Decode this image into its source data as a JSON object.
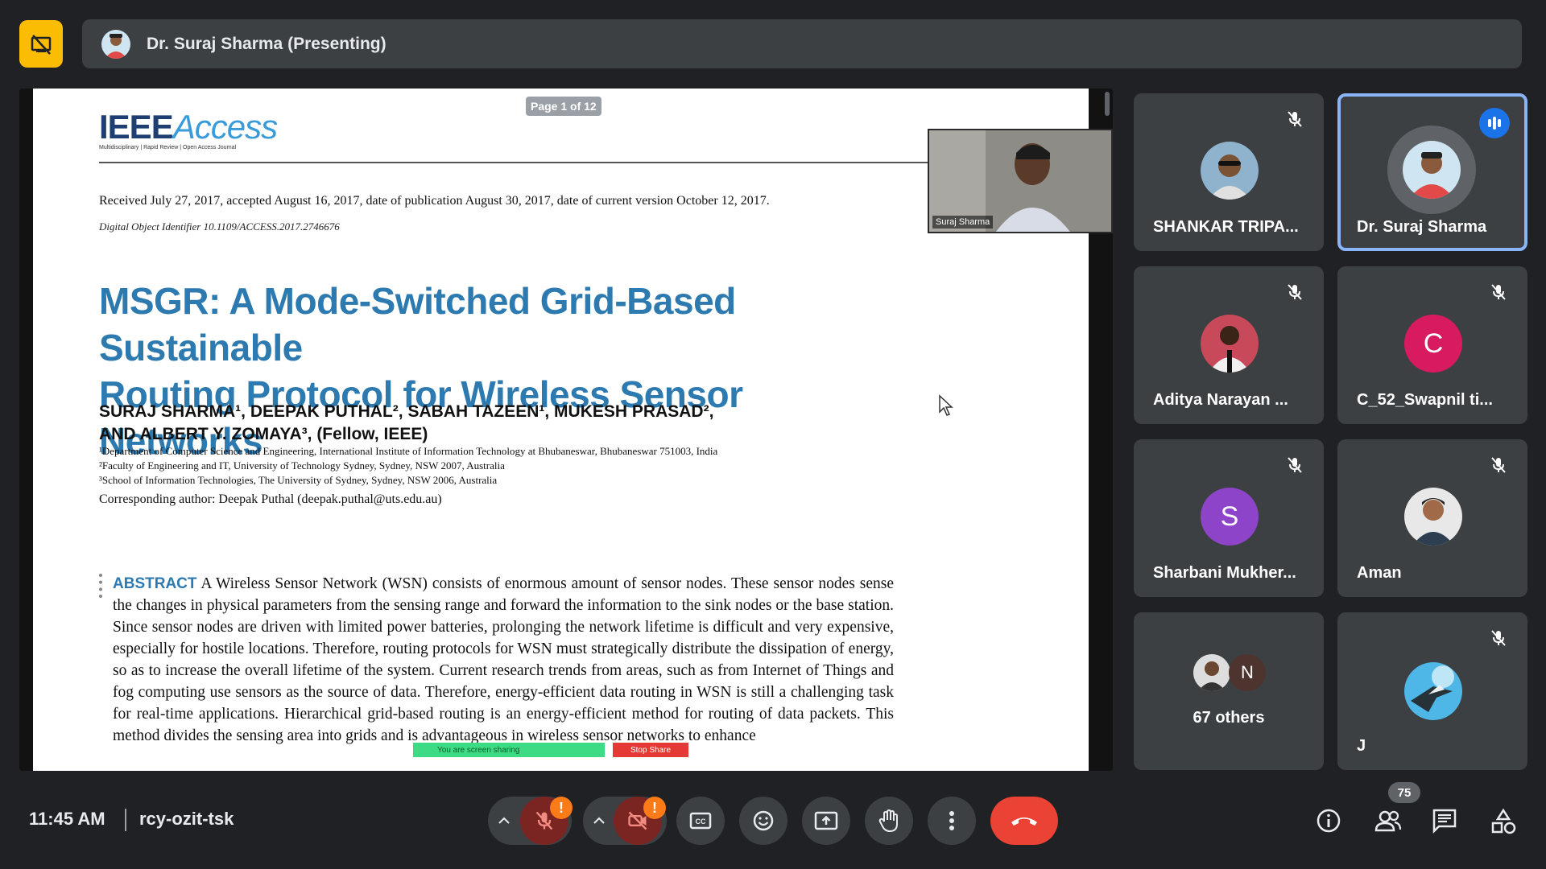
{
  "presenter_bar": {
    "label": "Dr. Suraj Sharma (Presenting)"
  },
  "document": {
    "page_indicator": "Page 1 of 12",
    "journal_logo_main": "IEEE",
    "journal_logo_accent": "Access",
    "journal_logo_sub": "Multidisciplinary | Rapid Review | Open Access Journal",
    "received_line": "Received July 27, 2017, accepted August 16, 2017, date of publication August 30, 2017, date of current version October 12, 2017.",
    "doi_line": "Digital Object Identifier 10.1109/ACCESS.2017.2746676",
    "title_line1": "MSGR: A Mode-Switched Grid-Based Sustainable",
    "title_line2": "Routing Protocol for Wireless Sensor Networks",
    "authors_line1": "SURAJ SHARMA¹, DEEPAK PUTHAL², SABAH TAZEEN¹, MUKESH PRASAD²,",
    "authors_line2": "AND ALBERT Y. ZOMAYA³, (Fellow, IEEE)",
    "affil1": "¹Department of Computer Science and Engineering, International Institute of Information Technology at Bhubaneswar, Bhubaneswar 751003, India",
    "affil2": "²Faculty of Engineering and IT, University of Technology Sydney, Sydney, NSW 2007, Australia",
    "affil3": "³School of Information Technologies, The University of Sydney, Sydney, NSW 2006, Australia",
    "corresponding": "Corresponding author: Deepak Puthal (deepak.puthal@uts.edu.au)",
    "abstract_label": "ABSTRACT",
    "abstract_text": " A Wireless Sensor Network (WSN) consists of enormous amount of sensor nodes. These sensor nodes sense the changes in physical parameters from the sensing range and forward the information to the sink nodes or the base station. Since sensor nodes are driven with limited power batteries, prolonging the network lifetime is difficult and very expensive, especially for hostile locations. Therefore, routing protocols for WSN must strategically distribute the dissipation of energy, so as to increase the overall lifetime of the system. Current research trends from areas, such as from Internet of Things and fog computing use sensors as the source of data. Therefore, energy-efficient data routing in WSN is still a challenging task for real-time applications. Hierarchical grid-based routing is an energy-efficient method for routing of data packets. This method divides the sensing area into grids and is advantageous in wireless sensor networks to enhance",
    "sharing_notice": "You are screen sharing",
    "stop_share": "Stop Share",
    "pip_name": "Suraj Sharma"
  },
  "participants": [
    {
      "name": "SHANKAR TRIPA...",
      "muted": true
    },
    {
      "name": "Dr. Suraj Sharma",
      "speaking": true
    },
    {
      "name": "Aditya Narayan ...",
      "muted": true
    },
    {
      "name": "C_52_Swapnil ti...",
      "initial": "C",
      "color": "#d81b60",
      "muted": true
    },
    {
      "name": "Sharbani Mukher...",
      "initial": "S",
      "color": "#8e44c9",
      "muted": true
    },
    {
      "name": "Aman",
      "muted": true
    },
    {
      "name": "67 others",
      "initial": "N"
    },
    {
      "name": "J",
      "muted": true
    }
  ],
  "bottom_bar": {
    "time": "11:45 AM",
    "meeting_code": "rcy-ozit-tsk",
    "warning_glyph": "!",
    "people_count": "75"
  },
  "colors": {
    "background": "#202124",
    "surface": "#3c4043",
    "accent_blue": "#8ab4f8",
    "end_call_red": "#ea4335",
    "pin_yellow": "#fbbc04",
    "title_blue": "#2c7ab0"
  },
  "icons": {
    "pin": "present-off-icon",
    "mic": "mic-off-icon",
    "camera": "camera-off-icon",
    "captions": "captions-icon",
    "emoji": "emoji-icon",
    "present": "present-screen-icon",
    "hand": "raise-hand-icon",
    "more": "more-vert-icon",
    "end_call": "end-call-icon",
    "info": "info-icon",
    "people": "people-icon",
    "chat": "chat-icon",
    "activities": "activities-icon"
  }
}
